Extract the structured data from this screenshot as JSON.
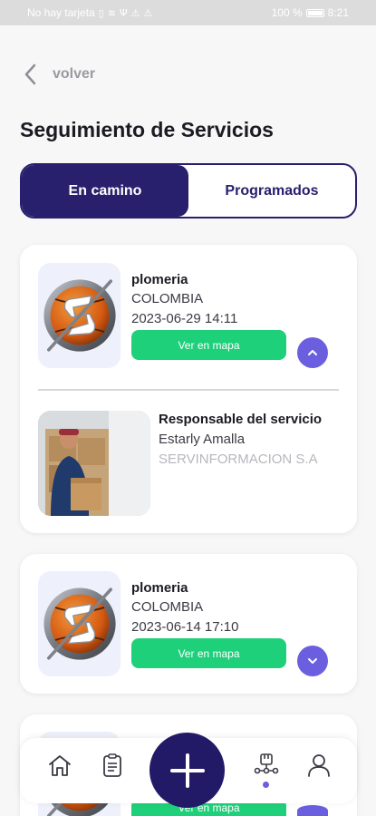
{
  "status_bar": {
    "carrier": "No hay tarjeta",
    "battery": "100 %",
    "time": "8:21"
  },
  "nav": {
    "back_label": "volver"
  },
  "page": {
    "title": "Seguimiento de Servicios"
  },
  "tabs": [
    {
      "label": "En camino",
      "active": true
    },
    {
      "label": "Programados",
      "active": false
    }
  ],
  "services": [
    {
      "name": "plomeria",
      "country": "COLOMBIA",
      "datetime": "2023-06-29 14:11",
      "map_button": "Ver en mapa",
      "expanded": true,
      "toggle_icon": "chevron-up-icon",
      "responsible": {
        "heading": "Responsable del servicio",
        "name": "Estarly Amalla",
        "company": "SERVINFORMACION S.A"
      }
    },
    {
      "name": "plomeria",
      "country": "COLOMBIA",
      "datetime": "2023-06-14 17:10",
      "map_button": "Ver en mapa",
      "expanded": false,
      "toggle_icon": "chevron-down-icon"
    },
    {
      "map_button": "Ver en mapa",
      "expanded": false
    }
  ],
  "bottom_nav": {
    "items": [
      "home-icon",
      "clipboard-icon",
      "add-icon",
      "tracking-icon",
      "profile-icon"
    ],
    "active": "tracking-icon"
  },
  "colors": {
    "primary": "#28206c",
    "accent": "#6b5fe0",
    "success": "#1fd07a",
    "background": "#f7f7f7"
  }
}
